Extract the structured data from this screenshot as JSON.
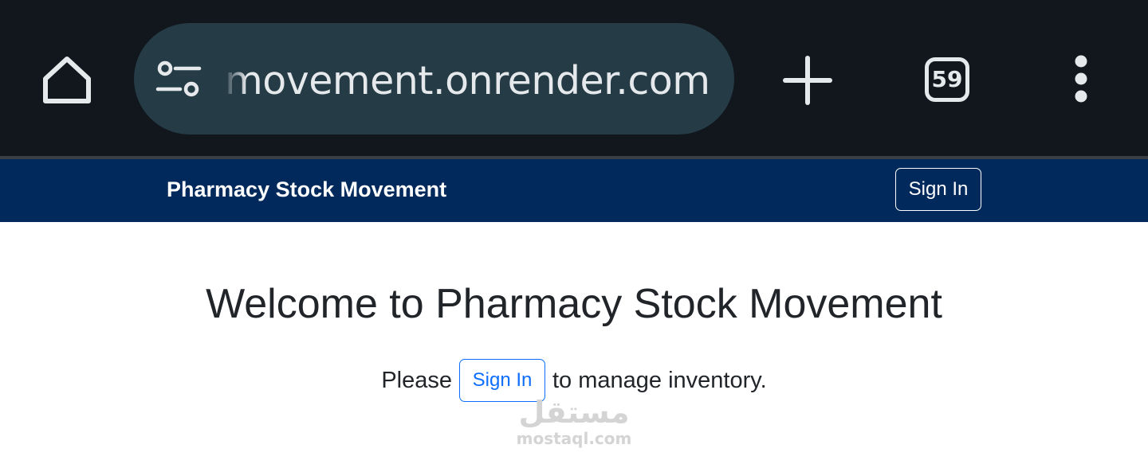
{
  "browser": {
    "url_text": "movement.onrender.com",
    "tab_count": "59",
    "icons": {
      "home": "home-icon",
      "site_settings": "site-settings-icon",
      "new_tab": "plus-icon",
      "tabs": "tab-switcher-icon",
      "menu": "more-vert-icon"
    }
  },
  "navbar": {
    "brand": "Pharmacy Stock Movement",
    "signin_label": "Sign In"
  },
  "main": {
    "title": "Welcome to Pharmacy Stock Movement",
    "prompt_before": "Please",
    "signin_label": "Sign In",
    "prompt_after": "to manage inventory."
  },
  "watermark": {
    "arabic": "مستقل",
    "latin": "mostaql.com"
  },
  "colors": {
    "browser_bar": "#12161d",
    "url_pill": "#253c47",
    "navbar": "#01295b",
    "link_blue": "#0d6efd",
    "text_dark": "#212529"
  }
}
